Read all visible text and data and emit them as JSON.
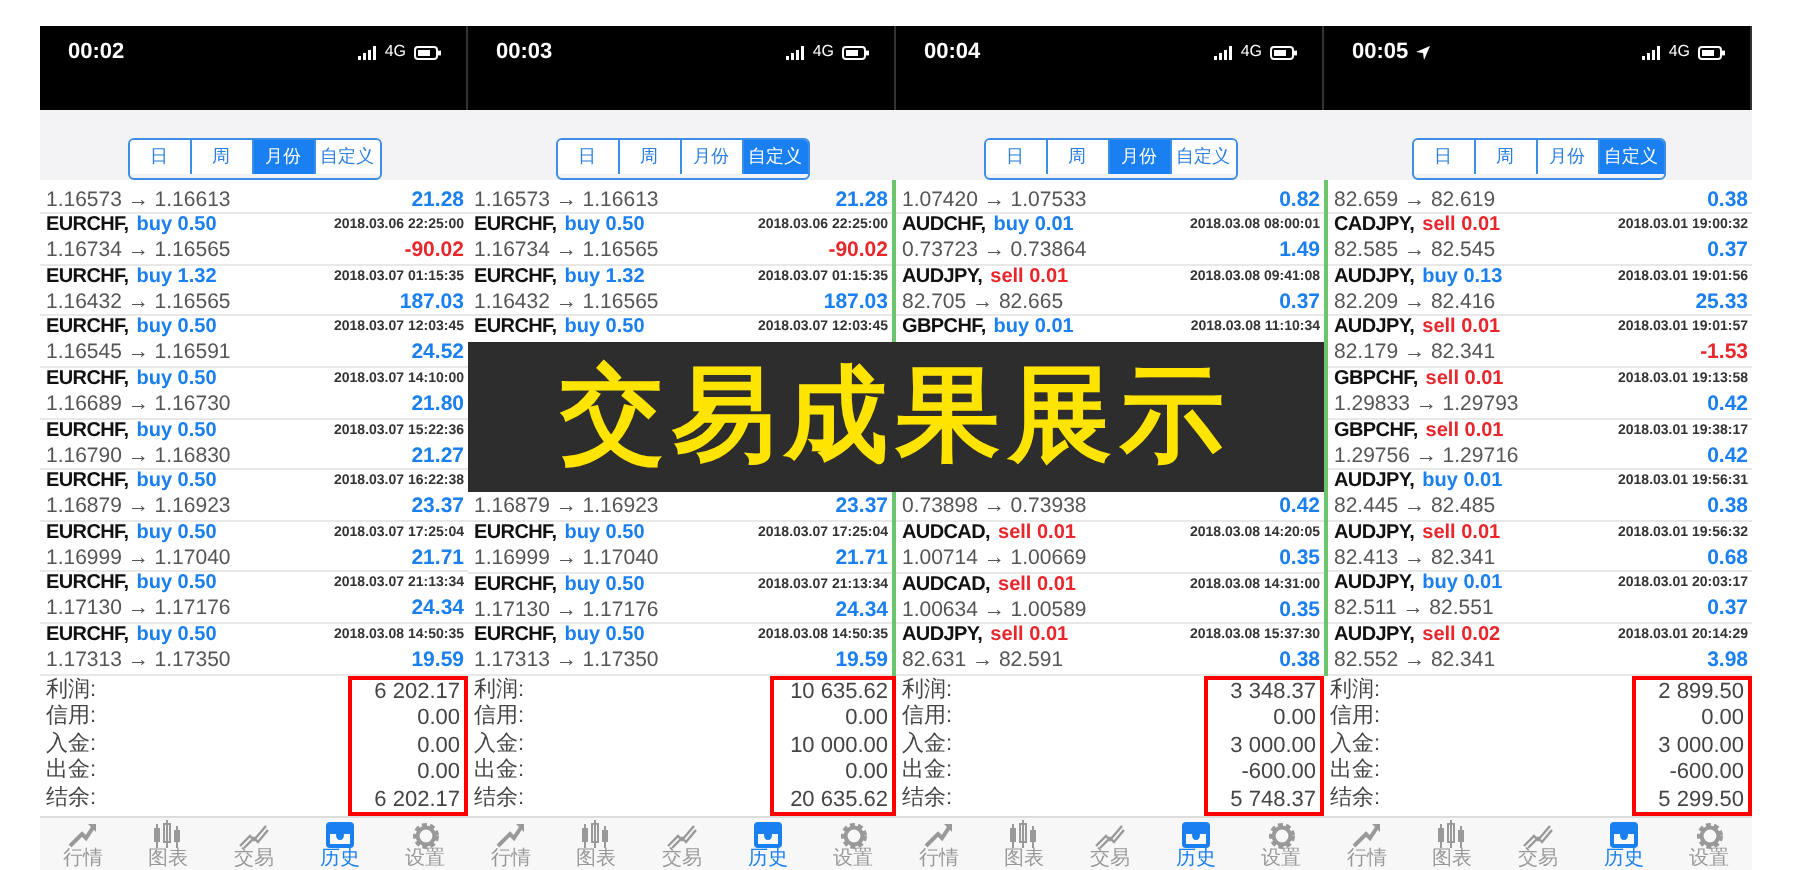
{
  "panels": [
    {
      "status": {
        "time": "00:02",
        "location": false,
        "network": "4G"
      },
      "periods": [
        {
          "label": "日",
          "selected": false
        },
        {
          "label": "周",
          "selected": false
        },
        {
          "label": "月份",
          "selected": true
        },
        {
          "label": "自定义",
          "selected": false
        }
      ],
      "trades": [
        {
          "prices": "1.16573 → 1.16613",
          "profit": "21.28",
          "loss": false
        },
        {
          "pair": "EURCHF,",
          "side": "buy",
          "lots": "0.50",
          "time": "2018.03.06 22:25:00",
          "prices": "1.16734 → 1.16565",
          "profit": "-90.02",
          "loss": true
        },
        {
          "pair": "EURCHF,",
          "side": "buy",
          "lots": "1.32",
          "time": "2018.03.07 01:15:35",
          "prices": "1.16432 → 1.16565",
          "profit": "187.03",
          "loss": false
        },
        {
          "pair": "EURCHF,",
          "side": "buy",
          "lots": "0.50",
          "time": "2018.03.07 12:03:45",
          "prices": "1.16545 → 1.16591",
          "profit": "24.52",
          "loss": false
        },
        {
          "pair": "EURCHF,",
          "side": "buy",
          "lots": "0.50",
          "time": "2018.03.07 14:10:00",
          "prices": "1.16689 → 1.16730",
          "profit": "21.80",
          "loss": false
        },
        {
          "pair": "EURCHF,",
          "side": "buy",
          "lots": "0.50",
          "time": "2018.03.07 15:22:36",
          "prices": "1.16790 → 1.16830",
          "profit": "21.27",
          "loss": false
        },
        {
          "pair": "EURCHF,",
          "side": "buy",
          "lots": "0.50",
          "time": "2018.03.07 16:22:38",
          "prices": "1.16879 → 1.16923",
          "profit": "23.37",
          "loss": false
        },
        {
          "pair": "EURCHF,",
          "side": "buy",
          "lots": "0.50",
          "time": "2018.03.07 17:25:04",
          "prices": "1.16999 → 1.17040",
          "profit": "21.71",
          "loss": false
        },
        {
          "pair": "EURCHF,",
          "side": "buy",
          "lots": "0.50",
          "time": "2018.03.07 21:13:34",
          "prices": "1.17130 → 1.17176",
          "profit": "24.34",
          "loss": false
        },
        {
          "pair": "EURCHF,",
          "side": "buy",
          "lots": "0.50",
          "time": "2018.03.08 14:50:35",
          "prices": "1.17313 → 1.17350",
          "profit": "19.59",
          "loss": false
        }
      ],
      "summary": [
        {
          "label": "利润:",
          "value": "6 202.17"
        },
        {
          "label": "信用:",
          "value": "0.00"
        },
        {
          "label": "入金:",
          "value": "0.00"
        },
        {
          "label": "出金:",
          "value": "0.00"
        },
        {
          "label": "结余:",
          "value": "6 202.17"
        }
      ],
      "tabs": [
        {
          "label": "行情",
          "selected": false
        },
        {
          "label": "图表",
          "selected": false
        },
        {
          "label": "交易",
          "selected": false
        },
        {
          "label": "历史",
          "selected": true
        },
        {
          "label": "设置",
          "selected": false
        }
      ]
    },
    {
      "status": {
        "time": "00:03",
        "location": false,
        "network": "4G"
      },
      "periods": [
        {
          "label": "日",
          "selected": false
        },
        {
          "label": "周",
          "selected": false
        },
        {
          "label": "月份",
          "selected": false
        },
        {
          "label": "自定义",
          "selected": true
        }
      ],
      "trades": [
        {
          "prices": "1.16573 → 1.16613",
          "profit": "21.28",
          "loss": false
        },
        {
          "pair": "EURCHF,",
          "side": "buy",
          "lots": "0.50",
          "time": "2018.03.06 22:25:00",
          "prices": "1.16734 → 1.16565",
          "profit": "-90.02",
          "loss": true
        },
        {
          "pair": "EURCHF,",
          "side": "buy",
          "lots": "1.32",
          "time": "2018.03.07 01:15:35",
          "prices": "1.16432 → 1.16565",
          "profit": "187.03",
          "loss": false
        },
        {
          "pair": "EURCHF,",
          "side": "buy",
          "lots": "0.50",
          "time": "2018.03.07 12:03:45"
        },
        {
          "prices": "1.16879 → 1.16923",
          "profit": "23.37",
          "loss": false
        },
        {
          "pair": "EURCHF,",
          "side": "buy",
          "lots": "0.50",
          "time": "2018.03.07 17:25:04",
          "prices": "1.16999 → 1.17040",
          "profit": "21.71",
          "loss": false
        },
        {
          "pair": "EURCHF,",
          "side": "buy",
          "lots": "0.50",
          "time": "2018.03.07 21:13:34",
          "prices": "1.17130 → 1.17176",
          "profit": "24.34",
          "loss": false
        },
        {
          "pair": "EURCHF,",
          "side": "buy",
          "lots": "0.50",
          "time": "2018.03.08 14:50:35",
          "prices": "1.17313 → 1.17350",
          "profit": "19.59",
          "loss": false
        }
      ],
      "summary": [
        {
          "label": "利润:",
          "value": "10 635.62"
        },
        {
          "label": "信用:",
          "value": "0.00"
        },
        {
          "label": "入金:",
          "value": "10 000.00"
        },
        {
          "label": "出金:",
          "value": "0.00"
        },
        {
          "label": "结余:",
          "value": "20 635.62"
        }
      ],
      "tabs": [
        {
          "label": "行情",
          "selected": false
        },
        {
          "label": "图表",
          "selected": false
        },
        {
          "label": "交易",
          "selected": false
        },
        {
          "label": "历史",
          "selected": true
        },
        {
          "label": "设置",
          "selected": false
        }
      ]
    },
    {
      "status": {
        "time": "00:04",
        "location": false,
        "network": "4G"
      },
      "periods": [
        {
          "label": "日",
          "selected": false
        },
        {
          "label": "周",
          "selected": false
        },
        {
          "label": "月份",
          "selected": true
        },
        {
          "label": "自定义",
          "selected": false
        }
      ],
      "trades": [
        {
          "prices": "1.07420 → 1.07533",
          "profit": "0.82",
          "loss": false
        },
        {
          "pair": "AUDCHF,",
          "side": "buy",
          "lots": "0.01",
          "time": "2018.03.08 08:00:01",
          "prices": "0.73723 → 0.73864",
          "profit": "1.49",
          "loss": false
        },
        {
          "pair": "AUDJPY,",
          "side": "sell",
          "lots": "0.01",
          "time": "2018.03.08 09:41:08",
          "prices": "82.705 → 82.665",
          "profit": "0.37",
          "loss": false
        },
        {
          "pair": "GBPCHF,",
          "side": "buy",
          "lots": "0.01",
          "time": "2018.03.08 11:10:34"
        },
        {
          "prices": "0.73898 → 0.73938",
          "profit": "0.42",
          "loss": false
        },
        {
          "pair": "AUDCAD,",
          "side": "sell",
          "lots": "0.01",
          "time": "2018.03.08 14:20:05",
          "prices": "1.00714 → 1.00669",
          "profit": "0.35",
          "loss": false
        },
        {
          "pair": "AUDCAD,",
          "side": "sell",
          "lots": "0.01",
          "time": "2018.03.08 14:31:00",
          "prices": "1.00634 → 1.00589",
          "profit": "0.35",
          "loss": false
        },
        {
          "pair": "AUDJPY,",
          "side": "sell",
          "lots": "0.01",
          "time": "2018.03.08 15:37:30",
          "prices": "82.631 → 82.591",
          "profit": "0.38",
          "loss": false
        }
      ],
      "summary": [
        {
          "label": "利润:",
          "value": "3 348.37"
        },
        {
          "label": "信用:",
          "value": "0.00"
        },
        {
          "label": "入金:",
          "value": "3 000.00"
        },
        {
          "label": "出金:",
          "value": "-600.00"
        },
        {
          "label": "结余:",
          "value": "5 748.37"
        }
      ],
      "tabs": [
        {
          "label": "行情",
          "selected": false
        },
        {
          "label": "图表",
          "selected": false
        },
        {
          "label": "交易",
          "selected": false
        },
        {
          "label": "历史",
          "selected": true
        },
        {
          "label": "设置",
          "selected": false
        }
      ]
    },
    {
      "status": {
        "time": "00:05",
        "location": true,
        "network": "4G"
      },
      "periods": [
        {
          "label": "日",
          "selected": false
        },
        {
          "label": "周",
          "selected": false
        },
        {
          "label": "月份",
          "selected": false
        },
        {
          "label": "自定义",
          "selected": true
        }
      ],
      "trades": [
        {
          "prices": "82.659 → 82.619",
          "profit": "0.38",
          "loss": false
        },
        {
          "pair": "CADJPY,",
          "side": "sell",
          "lots": "0.01",
          "time": "2018.03.01 19:00:32",
          "prices": "82.585 → 82.545",
          "profit": "0.37",
          "loss": false
        },
        {
          "pair": "AUDJPY,",
          "side": "buy",
          "lots": "0.13",
          "time": "2018.03.01 19:01:56",
          "prices": "82.209 → 82.416",
          "profit": "25.33",
          "loss": false
        },
        {
          "pair": "AUDJPY,",
          "side": "sell",
          "lots": "0.01",
          "time": "2018.03.01 19:01:57",
          "prices": "82.179 → 82.341",
          "profit": "-1.53",
          "loss": true
        },
        {
          "pair": "GBPCHF,",
          "side": "sell",
          "lots": "0.01",
          "time": "2018.03.01 19:13:58",
          "prices": "1.29833 → 1.29793",
          "profit": "0.42",
          "loss": false
        },
        {
          "pair": "GBPCHF,",
          "side": "sell",
          "lots": "0.01",
          "time": "2018.03.01 19:38:17",
          "prices": "1.29756 → 1.29716",
          "profit": "0.42",
          "loss": false
        },
        {
          "pair": "AUDJPY,",
          "side": "buy",
          "lots": "0.01",
          "time": "2018.03.01 19:56:31",
          "prices": "82.445 → 82.485",
          "profit": "0.38",
          "loss": false
        },
        {
          "pair": "AUDJPY,",
          "side": "sell",
          "lots": "0.01",
          "time": "2018.03.01 19:56:32",
          "prices": "82.413 → 82.341",
          "profit": "0.68",
          "loss": false
        },
        {
          "pair": "AUDJPY,",
          "side": "buy",
          "lots": "0.01",
          "time": "2018.03.01 20:03:17",
          "prices": "82.511 → 82.551",
          "profit": "0.37",
          "loss": false
        },
        {
          "pair": "AUDJPY,",
          "side": "sell",
          "lots": "0.02",
          "time": "2018.03.01 20:14:29",
          "prices": "82.552 → 82.341",
          "profit": "3.98",
          "loss": false
        }
      ],
      "summary": [
        {
          "label": "利润:",
          "value": "2 899.50"
        },
        {
          "label": "信用:",
          "value": "0.00"
        },
        {
          "label": "入金:",
          "value": "3 000.00"
        },
        {
          "label": "出金:",
          "value": "-600.00"
        },
        {
          "label": "结余:",
          "value": "5 299.50"
        }
      ],
      "tabs": [
        {
          "label": "行情",
          "selected": false
        },
        {
          "label": "图表",
          "selected": false
        },
        {
          "label": "交易",
          "selected": false
        },
        {
          "label": "历史",
          "selected": true
        },
        {
          "label": "设置",
          "selected": false
        }
      ]
    }
  ],
  "banner": {
    "text": "交易成果展示"
  }
}
